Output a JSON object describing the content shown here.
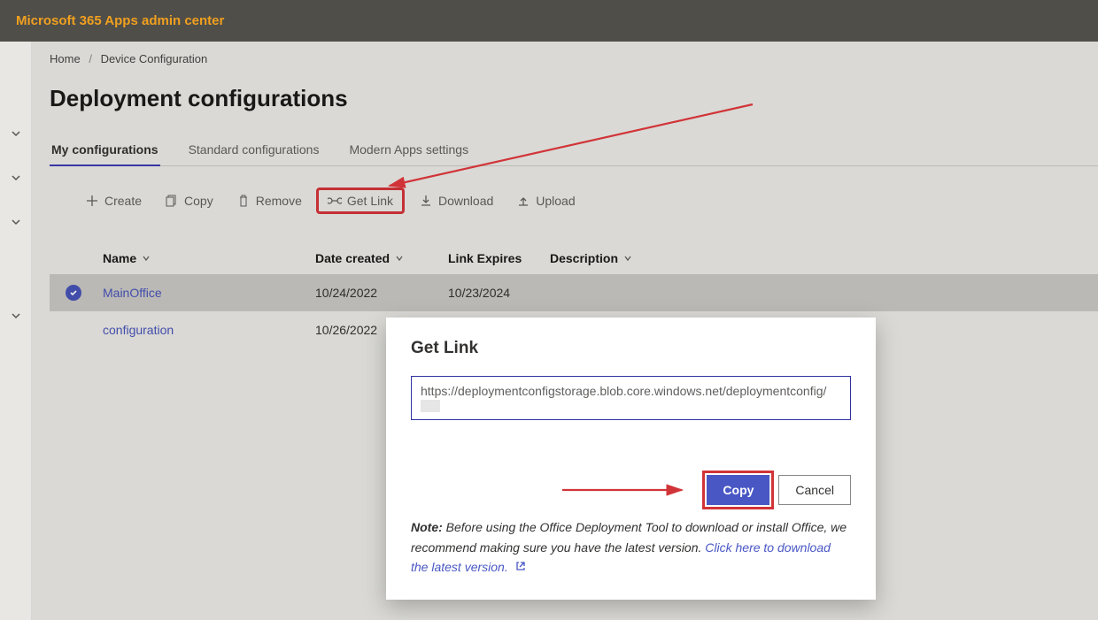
{
  "banner": {
    "title": "Microsoft 365 Apps admin center"
  },
  "breadcrumb": {
    "home": "Home",
    "current": "Device Configuration"
  },
  "page": {
    "title": "Deployment configurations"
  },
  "tabs": [
    {
      "label": "My configurations",
      "active": true
    },
    {
      "label": "Standard configurations",
      "active": false
    },
    {
      "label": "Modern Apps settings",
      "active": false
    }
  ],
  "commands": {
    "create": "Create",
    "copy": "Copy",
    "remove": "Remove",
    "getlink": "Get Link",
    "download": "Download",
    "upload": "Upload"
  },
  "columns": {
    "name": "Name",
    "date": "Date created",
    "expires": "Link Expires",
    "description": "Description"
  },
  "rows": [
    {
      "selected": true,
      "name": "MainOffice",
      "date": "10/24/2022",
      "expires": "10/23/2024",
      "description": ""
    },
    {
      "selected": false,
      "name": "configuration",
      "date": "10/26/2022",
      "expires": "",
      "description": ""
    }
  ],
  "modal": {
    "title": "Get Link",
    "url": "https://deploymentconfigstorage.blob.core.windows.net/deploymentconfig/",
    "copy": "Copy",
    "cancel": "Cancel",
    "note_prefix": "Note:",
    "note_body": " Before using the Office Deployment Tool to download or install Office, we recommend making sure you have the latest version. ",
    "note_link": "Click here to download the latest version."
  }
}
